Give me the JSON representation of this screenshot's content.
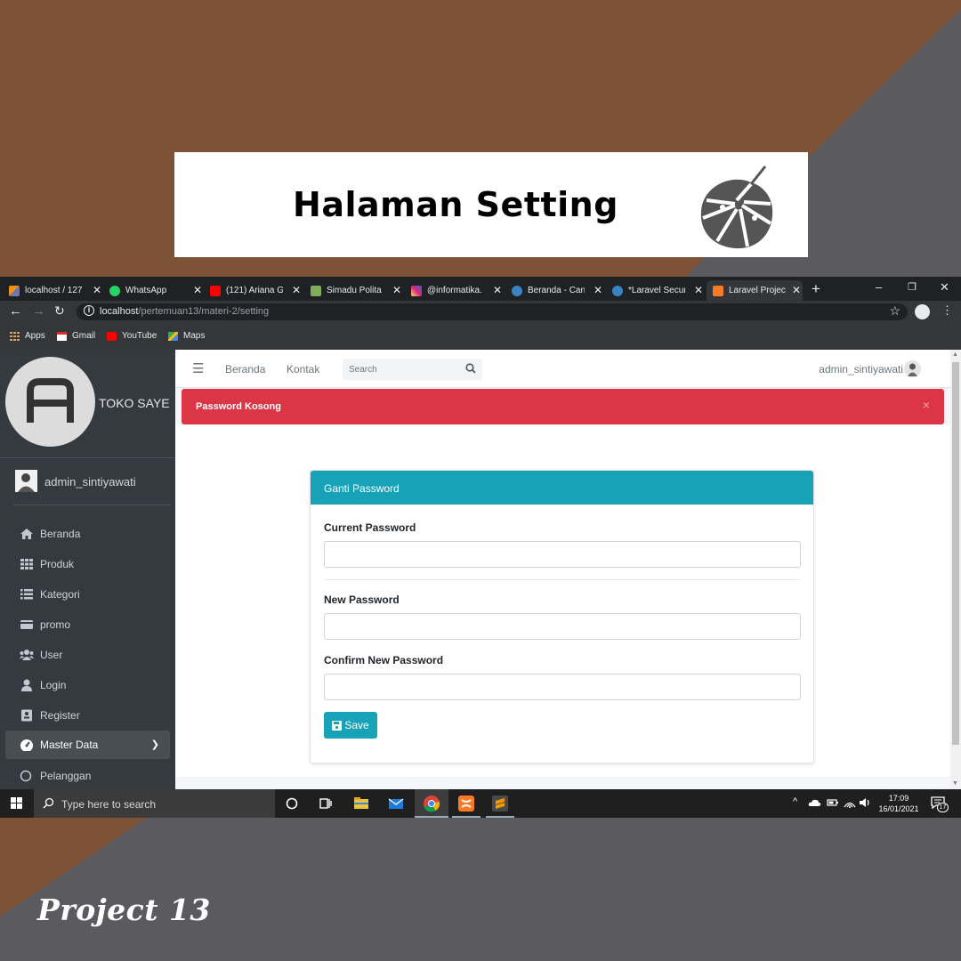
{
  "poster": {
    "title": "Halaman Setting",
    "footer": "Project 13",
    "colors": {
      "brown": "#7e5237",
      "gray": "#5b5b5f"
    }
  },
  "browser": {
    "tabs": [
      {
        "label": "localhost / 127",
        "icon": "phpmyadmin-icon"
      },
      {
        "label": "WhatsApp",
        "icon": "whatsapp-icon"
      },
      {
        "label": "(121) Ariana G",
        "icon": "youtube-icon"
      },
      {
        "label": "Simadu Polita",
        "icon": "simadu-icon"
      },
      {
        "label": "@informatika.",
        "icon": "instagram-icon"
      },
      {
        "label": "Beranda - Can",
        "icon": "canva-icon"
      },
      {
        "label": "*Laravel Secur",
        "icon": "canva-icon"
      },
      {
        "label": "Laravel Project",
        "icon": "xampp-icon",
        "active": true
      }
    ],
    "url_host": "localhost",
    "url_path": "/pertemuan13/materi-2/setting",
    "bookmarks": [
      "Apps",
      "Gmail",
      "YouTube",
      "Maps"
    ]
  },
  "sidebar": {
    "brand": "TOKO SAYE",
    "user": "admin_sintiyawati",
    "items": [
      {
        "label": "Beranda",
        "icon": "home-icon"
      },
      {
        "label": "Produk",
        "icon": "grid-icon"
      },
      {
        "label": "Kategori",
        "icon": "list-icon"
      },
      {
        "label": "promo",
        "icon": "card-icon"
      },
      {
        "label": "User",
        "icon": "users-icon"
      },
      {
        "label": "Login",
        "icon": "user-icon"
      },
      {
        "label": "Register",
        "icon": "id-card-icon"
      },
      {
        "label": "Master Data",
        "icon": "dashboard-icon",
        "active": true
      },
      {
        "label": "Pelanggan",
        "icon": "circle-icon"
      }
    ]
  },
  "topnav": {
    "links": [
      "Beranda",
      "Kontak"
    ],
    "search_placeholder": "Search",
    "user": "admin_sintiyawati"
  },
  "alert": {
    "message": "Password Kosong",
    "close": "×"
  },
  "form": {
    "header": "Ganti Password",
    "current_label": "Current Password",
    "new_label": "New Password",
    "confirm_label": "Confirm New Password",
    "save_label": "Save"
  },
  "taskbar": {
    "search_placeholder": "Type here to search",
    "time": "17:09",
    "date": "16/01/2021",
    "notifications": "17"
  }
}
